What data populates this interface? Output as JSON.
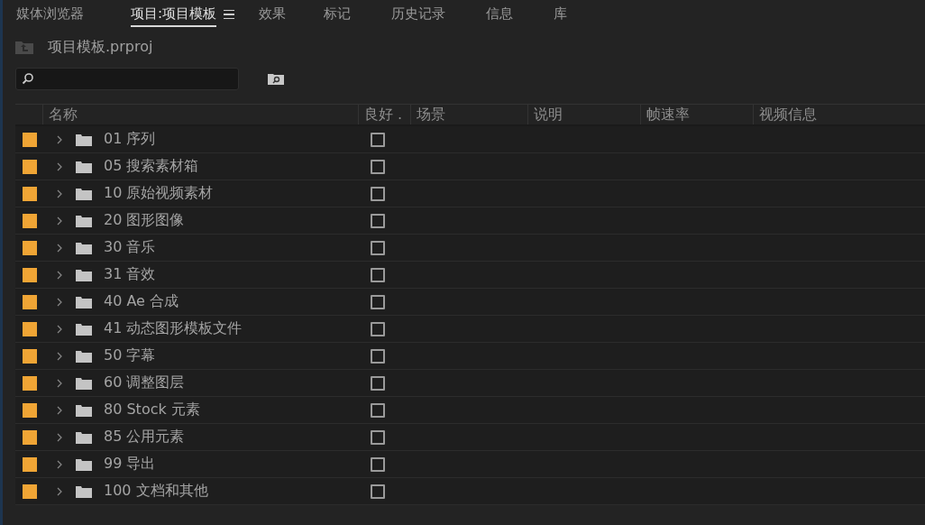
{
  "tabs": [
    {
      "label": "媒体浏览器",
      "selected": false
    },
    {
      "label": "项目:项目模板",
      "selected": true
    },
    {
      "label": "效果",
      "selected": false
    },
    {
      "label": "标记",
      "selected": false
    },
    {
      "label": "历史记录",
      "selected": false
    },
    {
      "label": "信息",
      "selected": false
    },
    {
      "label": "库",
      "selected": false
    }
  ],
  "project": {
    "file": "项目模板.prproj"
  },
  "table": {
    "columns": [
      "名称",
      "良好 .",
      "场景",
      "说明",
      "帧速率",
      "视频信息"
    ],
    "rows": [
      {
        "name": "01 序列",
        "color": "#f0a535",
        "expanded": false,
        "good": false
      },
      {
        "name": "05 搜索素材箱",
        "color": "#f0a535",
        "expanded": false,
        "good": false
      },
      {
        "name": "10 原始视频素材",
        "color": "#f0a535",
        "expanded": false,
        "good": false
      },
      {
        "name": "20 图形图像",
        "color": "#f0a535",
        "expanded": false,
        "good": false
      },
      {
        "name": "30 音乐",
        "color": "#f0a535",
        "expanded": false,
        "good": false
      },
      {
        "name": "31 音效",
        "color": "#f0a535",
        "expanded": false,
        "good": false
      },
      {
        "name": "40 Ae 合成",
        "color": "#f0a535",
        "expanded": false,
        "good": false
      },
      {
        "name": "41 动态图形模板文件",
        "color": "#f0a535",
        "expanded": false,
        "good": false
      },
      {
        "name": "50 字幕",
        "color": "#f0a535",
        "expanded": false,
        "good": false
      },
      {
        "name": "60 调整图层",
        "color": "#f0a535",
        "expanded": false,
        "good": false
      },
      {
        "name": "80 Stock 元素",
        "color": "#f0a535",
        "expanded": false,
        "good": false
      },
      {
        "name": "85 公用元素",
        "color": "#f0a535",
        "expanded": false,
        "good": false
      },
      {
        "name": "99 导出",
        "color": "#f0a535",
        "expanded": false,
        "good": false
      },
      {
        "name": "100 文档和其他",
        "color": "#f0a535",
        "expanded": false,
        "good": false
      }
    ]
  }
}
